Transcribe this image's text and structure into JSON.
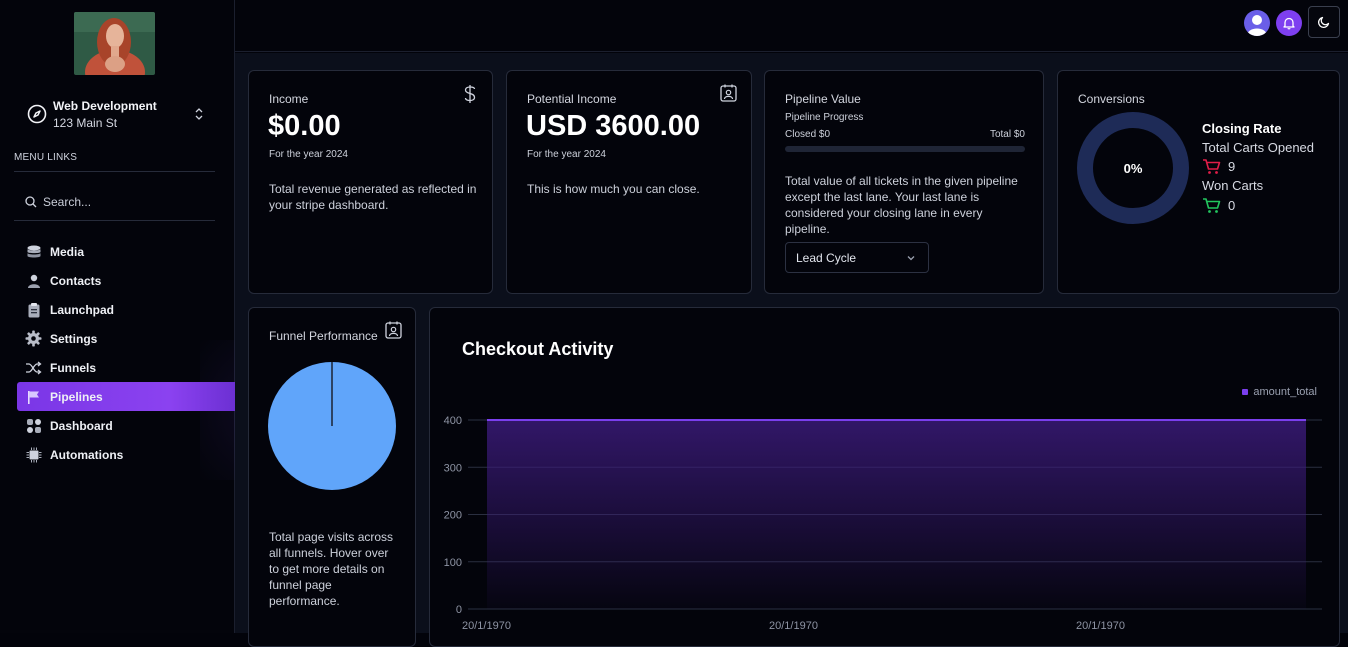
{
  "sidebar": {
    "account": {
      "name": "Web Development",
      "address": "123 Main St"
    },
    "menu_title": "MENU LINKS",
    "search_placeholder": "Search...",
    "items": [
      {
        "label": "Media",
        "icon": "database-icon",
        "active": false
      },
      {
        "label": "Contacts",
        "icon": "person-icon",
        "active": false
      },
      {
        "label": "Launchpad",
        "icon": "clipboard-icon",
        "active": false
      },
      {
        "label": "Settings",
        "icon": "gear-icon",
        "active": false
      },
      {
        "label": "Funnels",
        "icon": "shuffle-icon",
        "active": false
      },
      {
        "label": "Pipelines",
        "icon": "flag-icon",
        "active": true
      },
      {
        "label": "Dashboard",
        "icon": "grid-icon",
        "active": false
      },
      {
        "label": "Automations",
        "icon": "chip-icon",
        "active": false
      }
    ]
  },
  "cards": {
    "income": {
      "label": "Income",
      "value": "$0.00",
      "period": "For the year 2024",
      "description": "Total revenue generated as reflected in your stripe dashboard."
    },
    "potential": {
      "label": "Potential Income",
      "value": "USD 3600.00",
      "period": "For the year 2024",
      "description": "This is how much you can close."
    },
    "pipeline": {
      "label": "Pipeline Value",
      "progress_label": "Pipeline Progress",
      "closed": "Closed $0",
      "total": "Total $0",
      "progress": 0,
      "description": "Total value of all tickets in the given pipeline except the last lane. Your last lane is considered your closing lane in every pipeline.",
      "select_value": "Lead Cycle"
    },
    "conversions": {
      "label": "Conversions",
      "percent": "0%",
      "closing_rate": "Closing Rate",
      "carts_opened_label": "Total Carts Opened",
      "carts_opened": "9",
      "won_carts_label": "Won Carts",
      "won_carts": "0"
    },
    "funnel": {
      "label": "Funnel Performance",
      "description": "Total page visits across all funnels. Hover over to get more details on funnel page performance."
    }
  },
  "colors": {
    "accent": "#7b3fee",
    "pie": "#60a5fa",
    "donut": "#1e2b57",
    "cart_red": "#e11d48",
    "cart_green": "#22c55e"
  },
  "checkout": {
    "title": "Checkout Activity",
    "chart_data": {
      "type": "area",
      "series": [
        {
          "name": "amount_total",
          "values": [
            400,
            400
          ]
        }
      ],
      "x": [
        "20/1/1970",
        "20/1/1970"
      ],
      "x_tick_labels": [
        "20/1/1970",
        "20/1/1970",
        "20/1/1970"
      ],
      "y_ticks": [
        0,
        100,
        200,
        300,
        400
      ],
      "ylim": [
        0,
        400
      ],
      "grid": true,
      "legend": "top-right"
    }
  }
}
